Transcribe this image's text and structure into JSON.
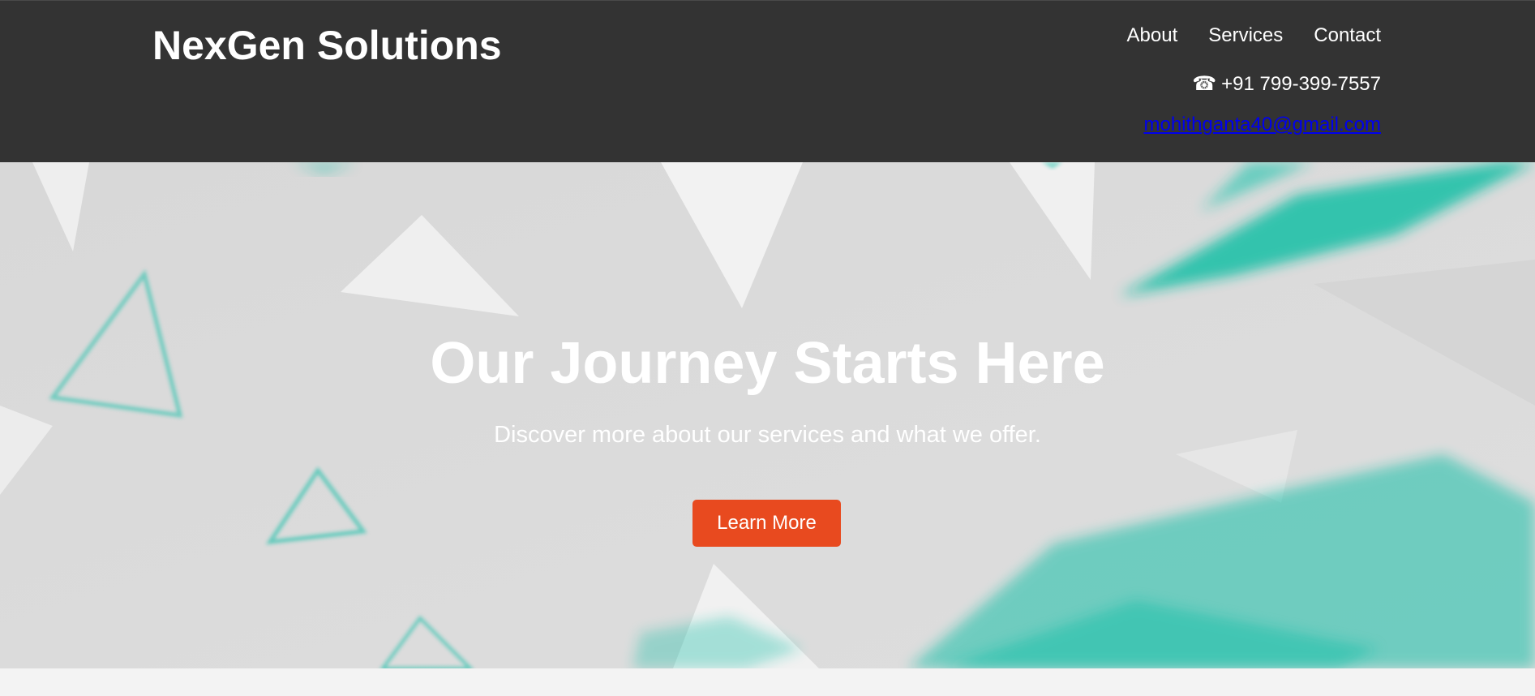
{
  "header": {
    "brand": "NexGen Solutions",
    "nav": [
      {
        "label": "About"
      },
      {
        "label": "Services"
      },
      {
        "label": "Contact"
      }
    ],
    "phone": {
      "icon": "phone-icon",
      "text": "+91 799-399-7557"
    },
    "email": "mohithganta40@gmail.com"
  },
  "hero": {
    "title": "Our Journey Starts Here",
    "subtitle": "Discover more about our services and what we offer.",
    "button_label": "Learn More"
  },
  "colors": {
    "header_bg": "#333333",
    "hero_bg": "#dcdcdc",
    "accent_button": "#e84a1f",
    "teal_shapes": "#19bfa8",
    "link": "#0000ee"
  }
}
